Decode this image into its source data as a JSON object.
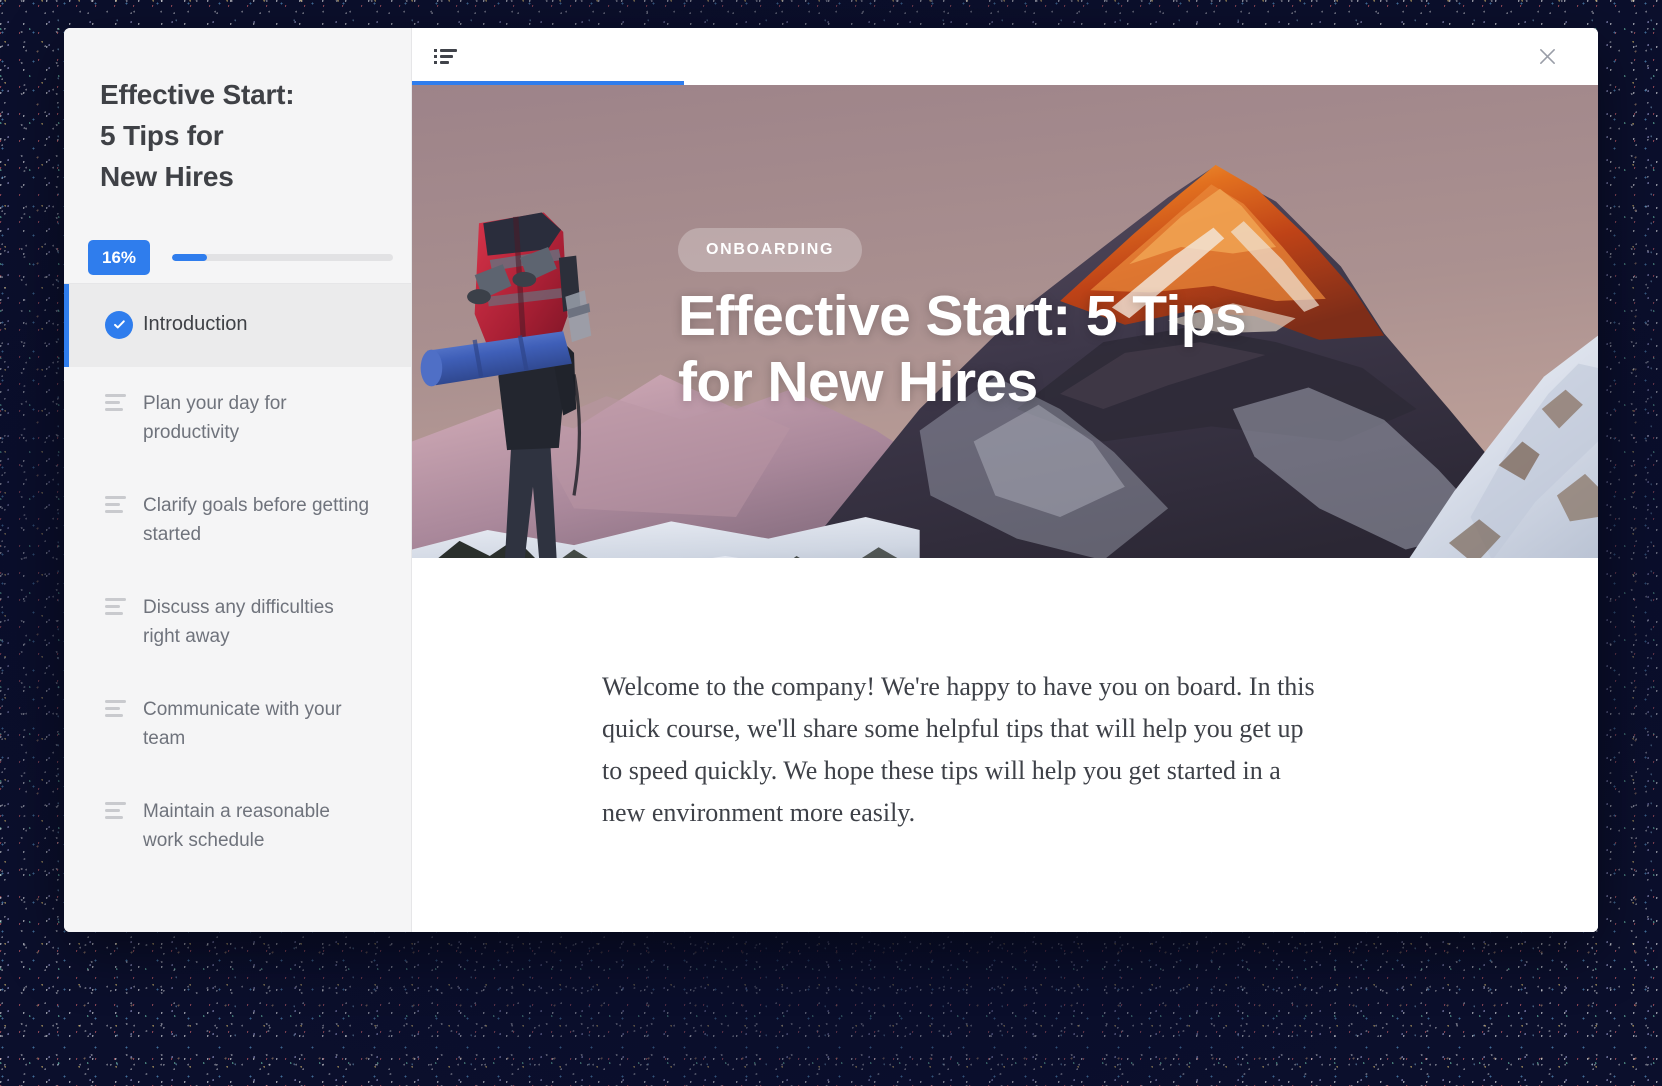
{
  "window": {
    "backdrop_color": "#0b0f2c",
    "card_background": "#ffffff"
  },
  "sidebar": {
    "course_title_lines": [
      "Effective Start:",
      "5 Tips for",
      "New Hires"
    ],
    "progress": {
      "label": "16%",
      "percent": 16,
      "accent_color": "#2f7ded",
      "track_color": "#e2e2e4"
    },
    "items": [
      {
        "label": "Introduction",
        "icon": "check-circle-icon",
        "state": "completed-active"
      },
      {
        "label": "Plan your day for productivity",
        "icon": "list-lines-icon",
        "state": "default"
      },
      {
        "label": "Clarify goals before getting started",
        "icon": "list-lines-icon",
        "state": "default"
      },
      {
        "label": "Discuss any difficulties right away",
        "icon": "list-lines-icon",
        "state": "default"
      },
      {
        "label": "Communicate with your team",
        "icon": "list-lines-icon",
        "state": "default"
      },
      {
        "label": "Maintain a reasonable work schedule",
        "icon": "list-lines-icon",
        "state": "default"
      }
    ]
  },
  "topbar": {
    "tabs": [
      {
        "icon": "bulleted-list-icon",
        "label": "",
        "active": true
      }
    ],
    "close_icon": "close-icon",
    "active_tab_indicator_color": "#2f7ded"
  },
  "hero": {
    "badge": "ONBOARDING",
    "title": "Effective Start: 5 Tips for New Hires",
    "image_description": "Hiker with a large red backpack and blue sleeping roll standing on a snowy ridge facing a sunlit orange mountain summit under a dusty mauve sky",
    "sky_color": "#a68f8e",
    "summit_color": "#c24a1c",
    "snow_color": "#dfe3ec"
  },
  "content": {
    "paragraph": "Welcome to the company! We're happy to have you on board. In this quick course, we'll share some helpful tips that will help you get up to speed quickly. We hope these tips will help you get started in a new environment more easily."
  }
}
